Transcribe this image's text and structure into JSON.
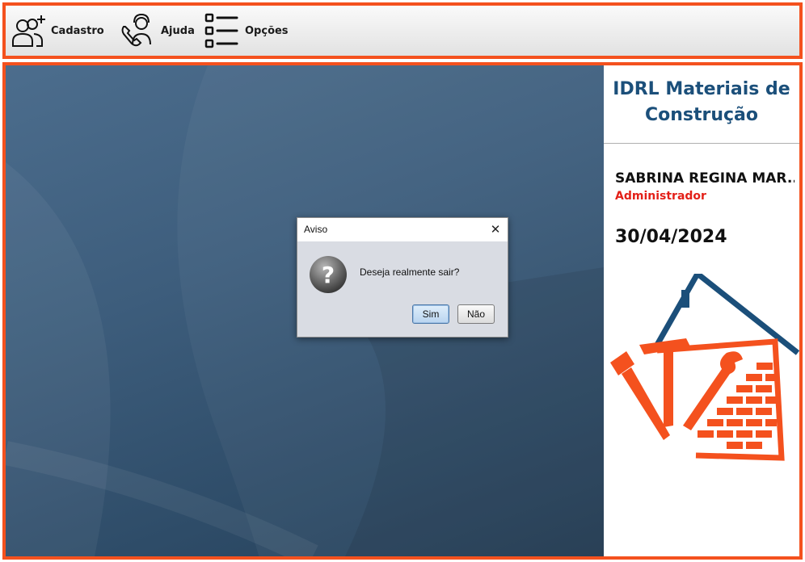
{
  "toolbar": {
    "items": [
      {
        "label": "Cadastro",
        "icon": "add-user-icon"
      },
      {
        "label": "Ajuda",
        "icon": "support-agent-icon"
      },
      {
        "label": "Opções",
        "icon": "options-list-icon"
      }
    ]
  },
  "sidebar": {
    "company_name": "IDRL Materiais de Construção",
    "user_name": "SABRINA REGINA MAR...",
    "user_role": "Administrador",
    "date": "30/04/2024",
    "logo_icon": "construction-tools-house-logo"
  },
  "dialog": {
    "title": "Aviso",
    "message": "Deseja realmente sair?",
    "icon": "question-icon",
    "buttons": {
      "yes": "Sim",
      "no": "Não"
    }
  },
  "colors": {
    "accent_border": "#f4511e",
    "company_text": "#1b4f7a",
    "role_text": "#e32018",
    "desktop_bg": "#3d5d7c"
  }
}
